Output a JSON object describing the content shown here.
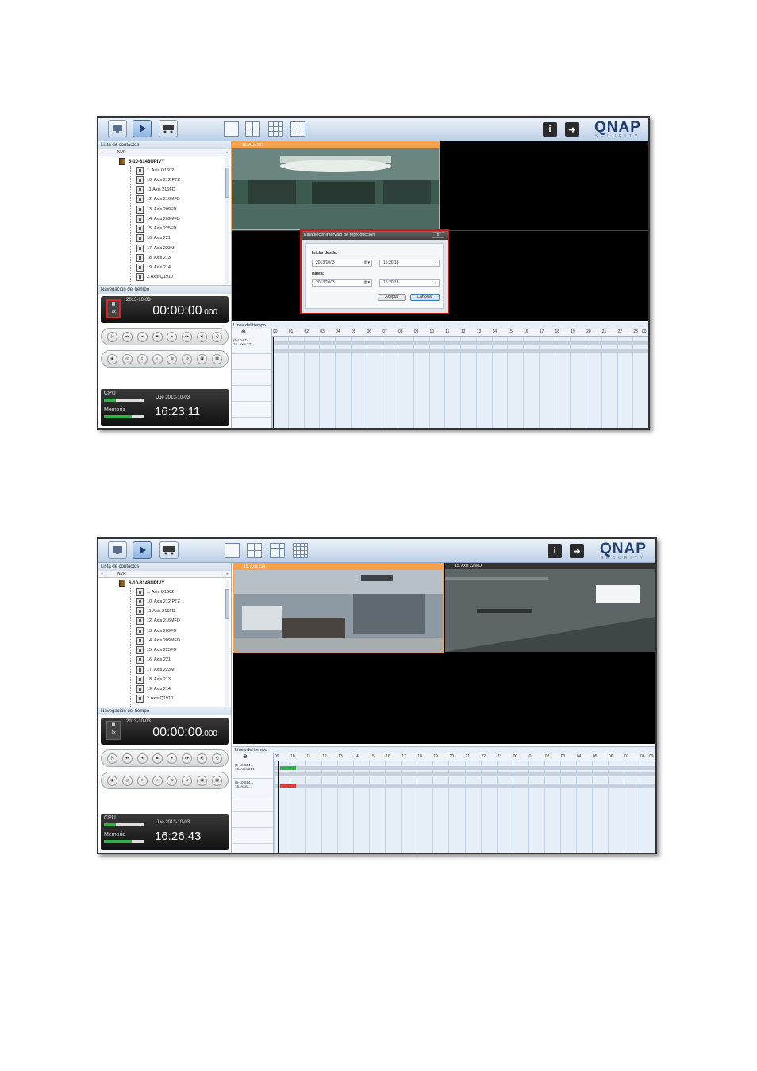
{
  "toolbar": {
    "mode_icons": [
      "monitor-icon",
      "playback-icon",
      "settings-icon"
    ],
    "layout_icons": [
      "layout-1x1-icon",
      "layout-2x2-icon",
      "layout-3x3-icon",
      "layout-4x4-icon"
    ],
    "info_icon": "i",
    "logo": "QNAP",
    "logo_sub": "SECURITY"
  },
  "sidebar": {
    "contacts_title": "Lista de contactos",
    "tab": "NVR",
    "nvr_name": "6-10-8148UPIVY",
    "timenav_title": "Navegación del tiempo",
    "speed": "1x"
  },
  "screenshot1": {
    "cameras": [
      "1. Axis Q1602",
      "10. Axis 212 PTZ",
      "11.Axis 216FD",
      "12. Axis 216MFD",
      "13. Axis 209FD",
      "14. Axis 209MFD",
      "15. Axis 225FD",
      "16. Axis 221",
      "17. Axis 223M",
      "18. Axis 213",
      "19. Axis 214",
      "2.Axis Q1910"
    ],
    "clock_date": "2013-10-03",
    "clock_time": "00:00:00",
    "clock_ms": ".000",
    "cpu_label": "CPU",
    "mem_label": "Memoria",
    "day": "Jue  2013-10-03",
    "now": "16:23:11",
    "cell_header": "16. Axis 221",
    "timeline_title": "Línea del tiempo",
    "timeline_row": "(6-10-814...\n16. Axis 221",
    "hours": [
      "00",
      "01",
      "02",
      "03",
      "04",
      "05",
      "06",
      "07",
      "08",
      "09",
      "10",
      "11",
      "12",
      "13",
      "14",
      "15",
      "16",
      "17",
      "18",
      "19",
      "20",
      "21",
      "22",
      "23",
      "00"
    ],
    "dialog": {
      "title": "Establecer intervalo de reproducción",
      "close": "x",
      "from_label": "Iniciar desde:",
      "from_date": "2013/10/  3",
      "from_time": "15:20:18",
      "to_label": "Hasta:",
      "to_date": "2013/10/  3",
      "to_time": "16:20:18",
      "ok": "Aceptar",
      "cancel": "Cancelar"
    }
  },
  "screenshot2": {
    "cameras": [
      "1. Axis Q1602",
      "10. Axis 212 PTZ",
      "11.Axis 216FD",
      "12. Axis 216MFD",
      "13. Axis 209FD",
      "14. Axis 209MFD",
      "15. Axis 225FD",
      "16. Axis 221",
      "17. Axis 223M",
      "18. Axis 213",
      "19. Axis 214",
      "2.Axis Q1910"
    ],
    "clock_date": "2013-10-03",
    "clock_time": "00:00:00",
    "clock_ms": ".000",
    "cpu_label": "CPU",
    "mem_label": "Memoria",
    "day": "Jue  2013-10-03",
    "now": "16:26:43",
    "cell1_header": "19. Axis 214",
    "cell2_header": "15. Axis 225FD",
    "timeline_title": "Línea del tiempo",
    "timeline_rows": [
      "(6-10-814...\n19. Axis 214",
      "(6-10-814...\n15. Axis ..."
    ],
    "hours": [
      "09",
      "10",
      "11",
      "12",
      "13",
      "14",
      "15",
      "16",
      "17",
      "18",
      "19",
      "20",
      "21",
      "22",
      "23",
      "00",
      "01",
      "02",
      "03",
      "04",
      "05",
      "06",
      "07",
      "08",
      "09"
    ]
  },
  "colors": {
    "accent": "#f7a24a",
    "highlight": "#d01818",
    "record_green": "#2fb24a",
    "record_red": "#e23a3a"
  }
}
